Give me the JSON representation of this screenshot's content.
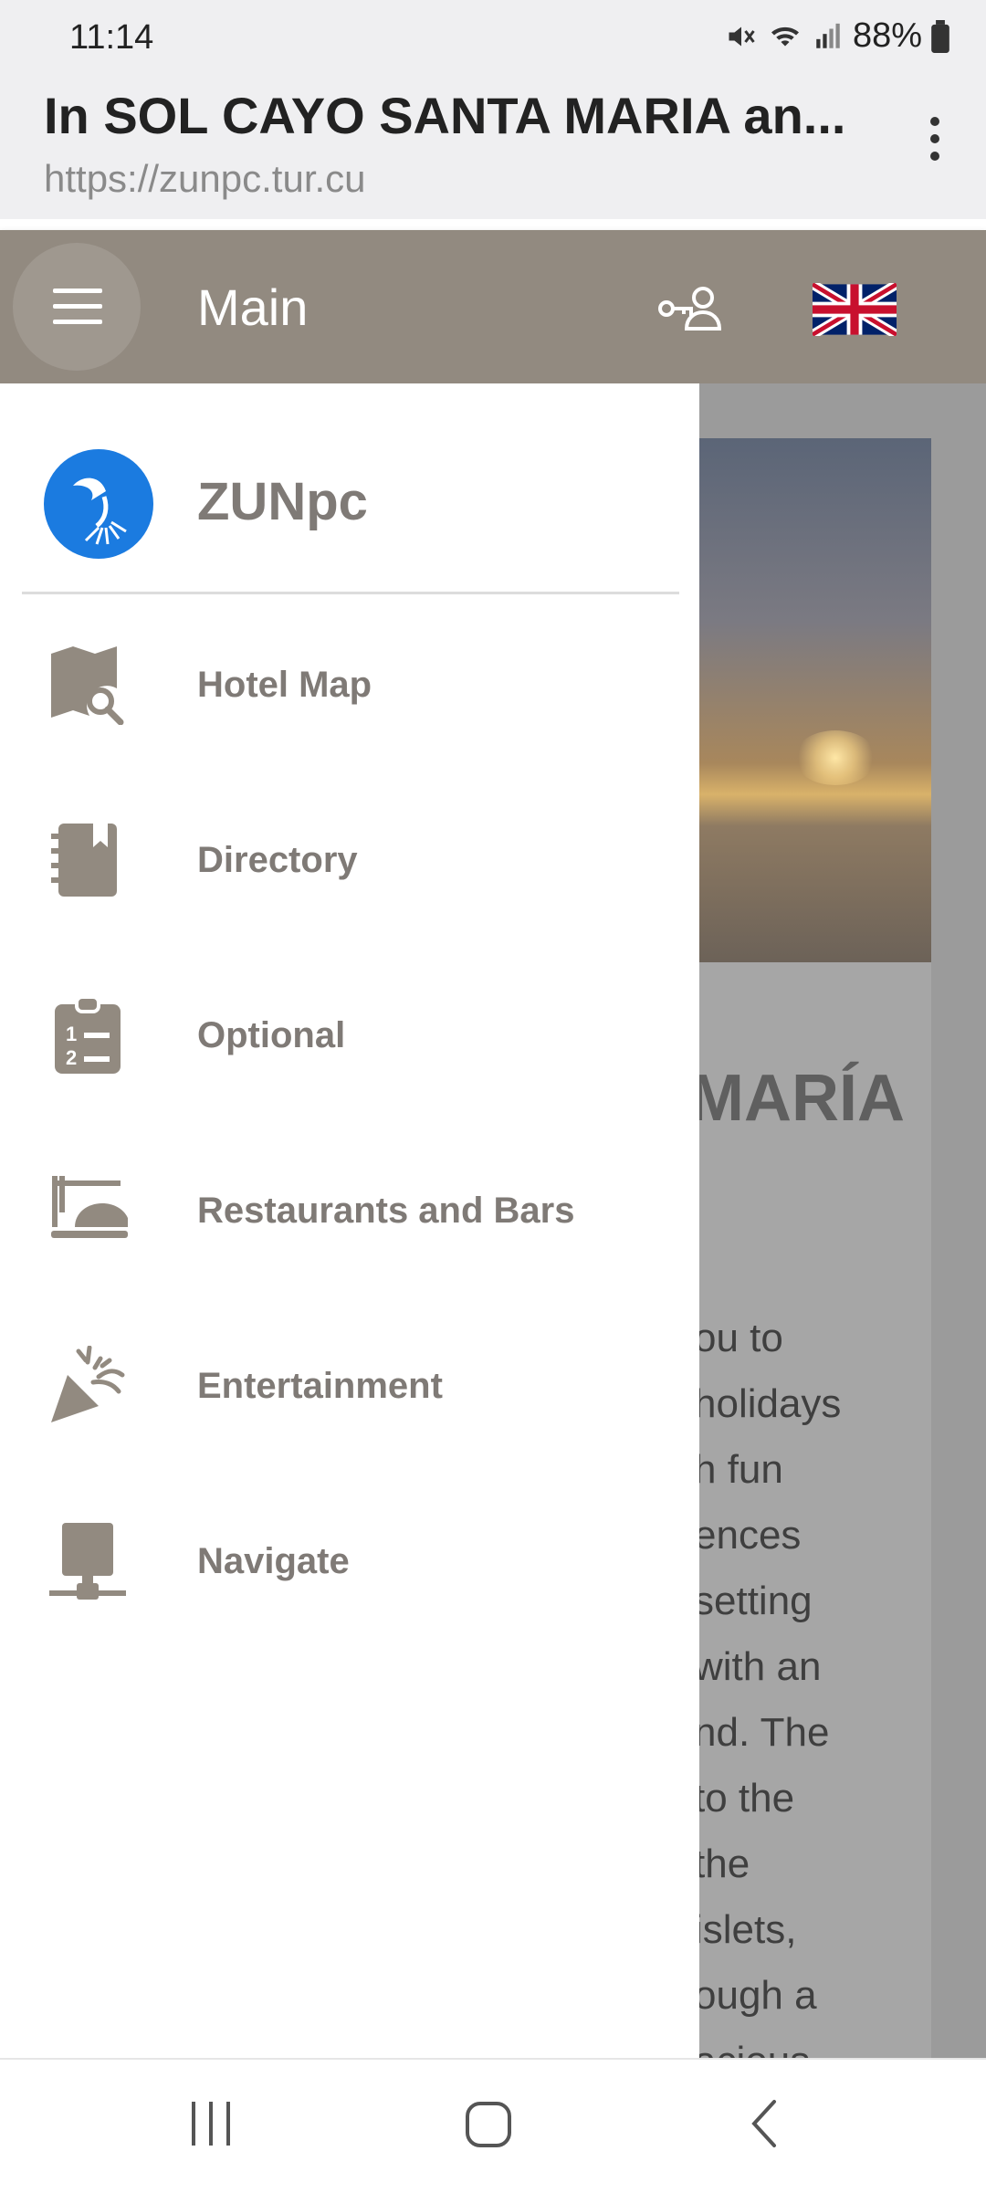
{
  "status_bar": {
    "time": "11:14",
    "battery": "88%"
  },
  "browser": {
    "title": "In SOL CAYO SANTA MARIA an...",
    "url": "https://zunpc.tur.cu"
  },
  "header": {
    "title": "Main"
  },
  "drawer": {
    "brand": "ZUNpc",
    "items": [
      {
        "label": "Hotel Map",
        "icon": "map-search-icon"
      },
      {
        "label": "Directory",
        "icon": "notebook-icon"
      },
      {
        "label": "Optional",
        "icon": "clipboard-list-icon"
      },
      {
        "label": "Restaurants and Bars",
        "icon": "food-tray-icon"
      },
      {
        "label": "Entertainment",
        "icon": "party-popper-icon"
      },
      {
        "label": "Navigate",
        "icon": "network-icon"
      }
    ]
  },
  "background_page": {
    "heading": "MARÍA",
    "lines": [
      "ou to",
      "holidays",
      "h fun",
      "ences",
      "setting",
      "with an",
      "nd. The",
      "to the",
      "the",
      "islets,",
      "ough a",
      "acious"
    ]
  },
  "colors": {
    "header": "#928a80",
    "brand_blue": "#1b7be0",
    "drawer_text": "#7f7a76"
  }
}
